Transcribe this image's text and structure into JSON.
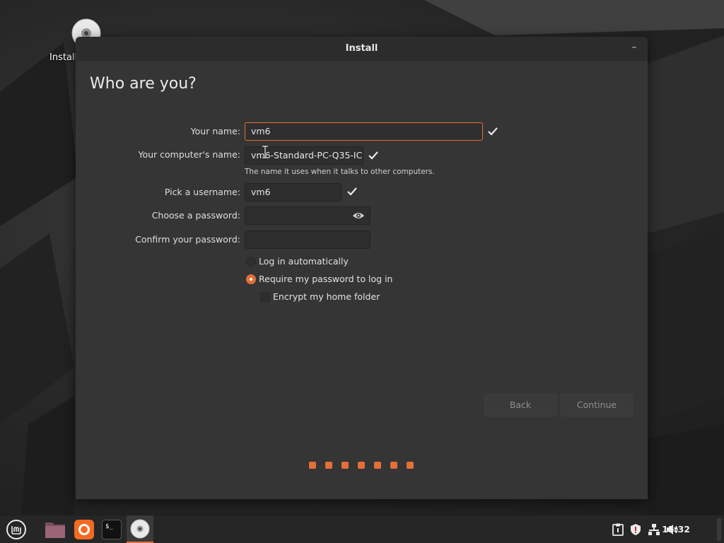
{
  "desktop": {
    "icon_label": "Install"
  },
  "window": {
    "title": "Install",
    "minimize_glyph": "–",
    "heading": "Who are you?"
  },
  "form": {
    "your_name": {
      "label": "Your name:",
      "value": "vm6"
    },
    "computer_name": {
      "label": "Your computer's name:",
      "value": "vm6-Standard-PC-Q35-IC",
      "hint": "The name it uses when it talks to other computers."
    },
    "username": {
      "label": "Pick a username:",
      "value": "vm6"
    },
    "password": {
      "label": "Choose a password:",
      "value": ""
    },
    "confirm_password": {
      "label": "Confirm your password:",
      "value": ""
    },
    "options": {
      "login_auto": {
        "label": "Log in automatically",
        "selected": false
      },
      "require_password": {
        "label": "Require my password to log in",
        "selected": true
      },
      "encrypt_home": {
        "label": "Encrypt my home folder",
        "checked": false
      }
    }
  },
  "buttons": {
    "back": "Back",
    "continue": "Continue"
  },
  "progress": {
    "total_steps": 7,
    "color": "#e46f39"
  },
  "taskbar": {
    "clock": "15:32",
    "apps": [
      "menu-icon",
      "files-icon",
      "firefox-icon",
      "terminal-icon",
      "installer-icon"
    ],
    "tray": [
      "clipboard-icon",
      "shield-icon",
      "network-icon",
      "volume-icon"
    ],
    "terminal_glyph": "$_"
  },
  "colors": {
    "accent": "#e46f39",
    "window_bg": "#353535",
    "titlebar_bg": "#2c2c2c"
  }
}
